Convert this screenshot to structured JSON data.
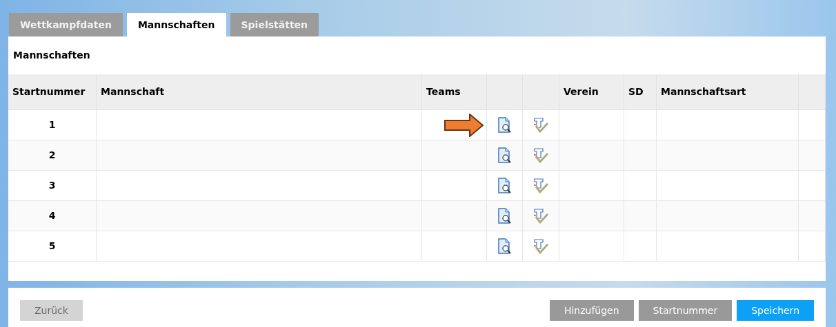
{
  "tabs": [
    {
      "label": "Wettkampfdaten",
      "selected": false
    },
    {
      "label": "Mannschaften",
      "selected": true
    },
    {
      "label": "Spielstätten",
      "selected": false
    }
  ],
  "section_title": "Mannschaften",
  "table": {
    "columns": [
      "Startnummer",
      "Mannschaft",
      "Teams",
      "",
      "",
      "Verein",
      "SD",
      "Mannschaftsart",
      ""
    ],
    "rows": [
      {
        "startnummer": "1",
        "highlighted": true
      },
      {
        "startnummer": "2",
        "highlighted": false
      },
      {
        "startnummer": "3",
        "highlighted": false
      },
      {
        "startnummer": "4",
        "highlighted": false
      },
      {
        "startnummer": "5",
        "highlighted": false
      }
    ]
  },
  "buttons": [
    {
      "label": "Zurück",
      "kind": "secondary",
      "disabled": true
    },
    {
      "label": "Hinzufügen",
      "kind": "secondary",
      "disabled": false
    },
    {
      "label": "Startnummer",
      "kind": "secondary",
      "disabled": false
    },
    {
      "label": "Speichern",
      "kind": "primary",
      "disabled": false
    }
  ]
}
